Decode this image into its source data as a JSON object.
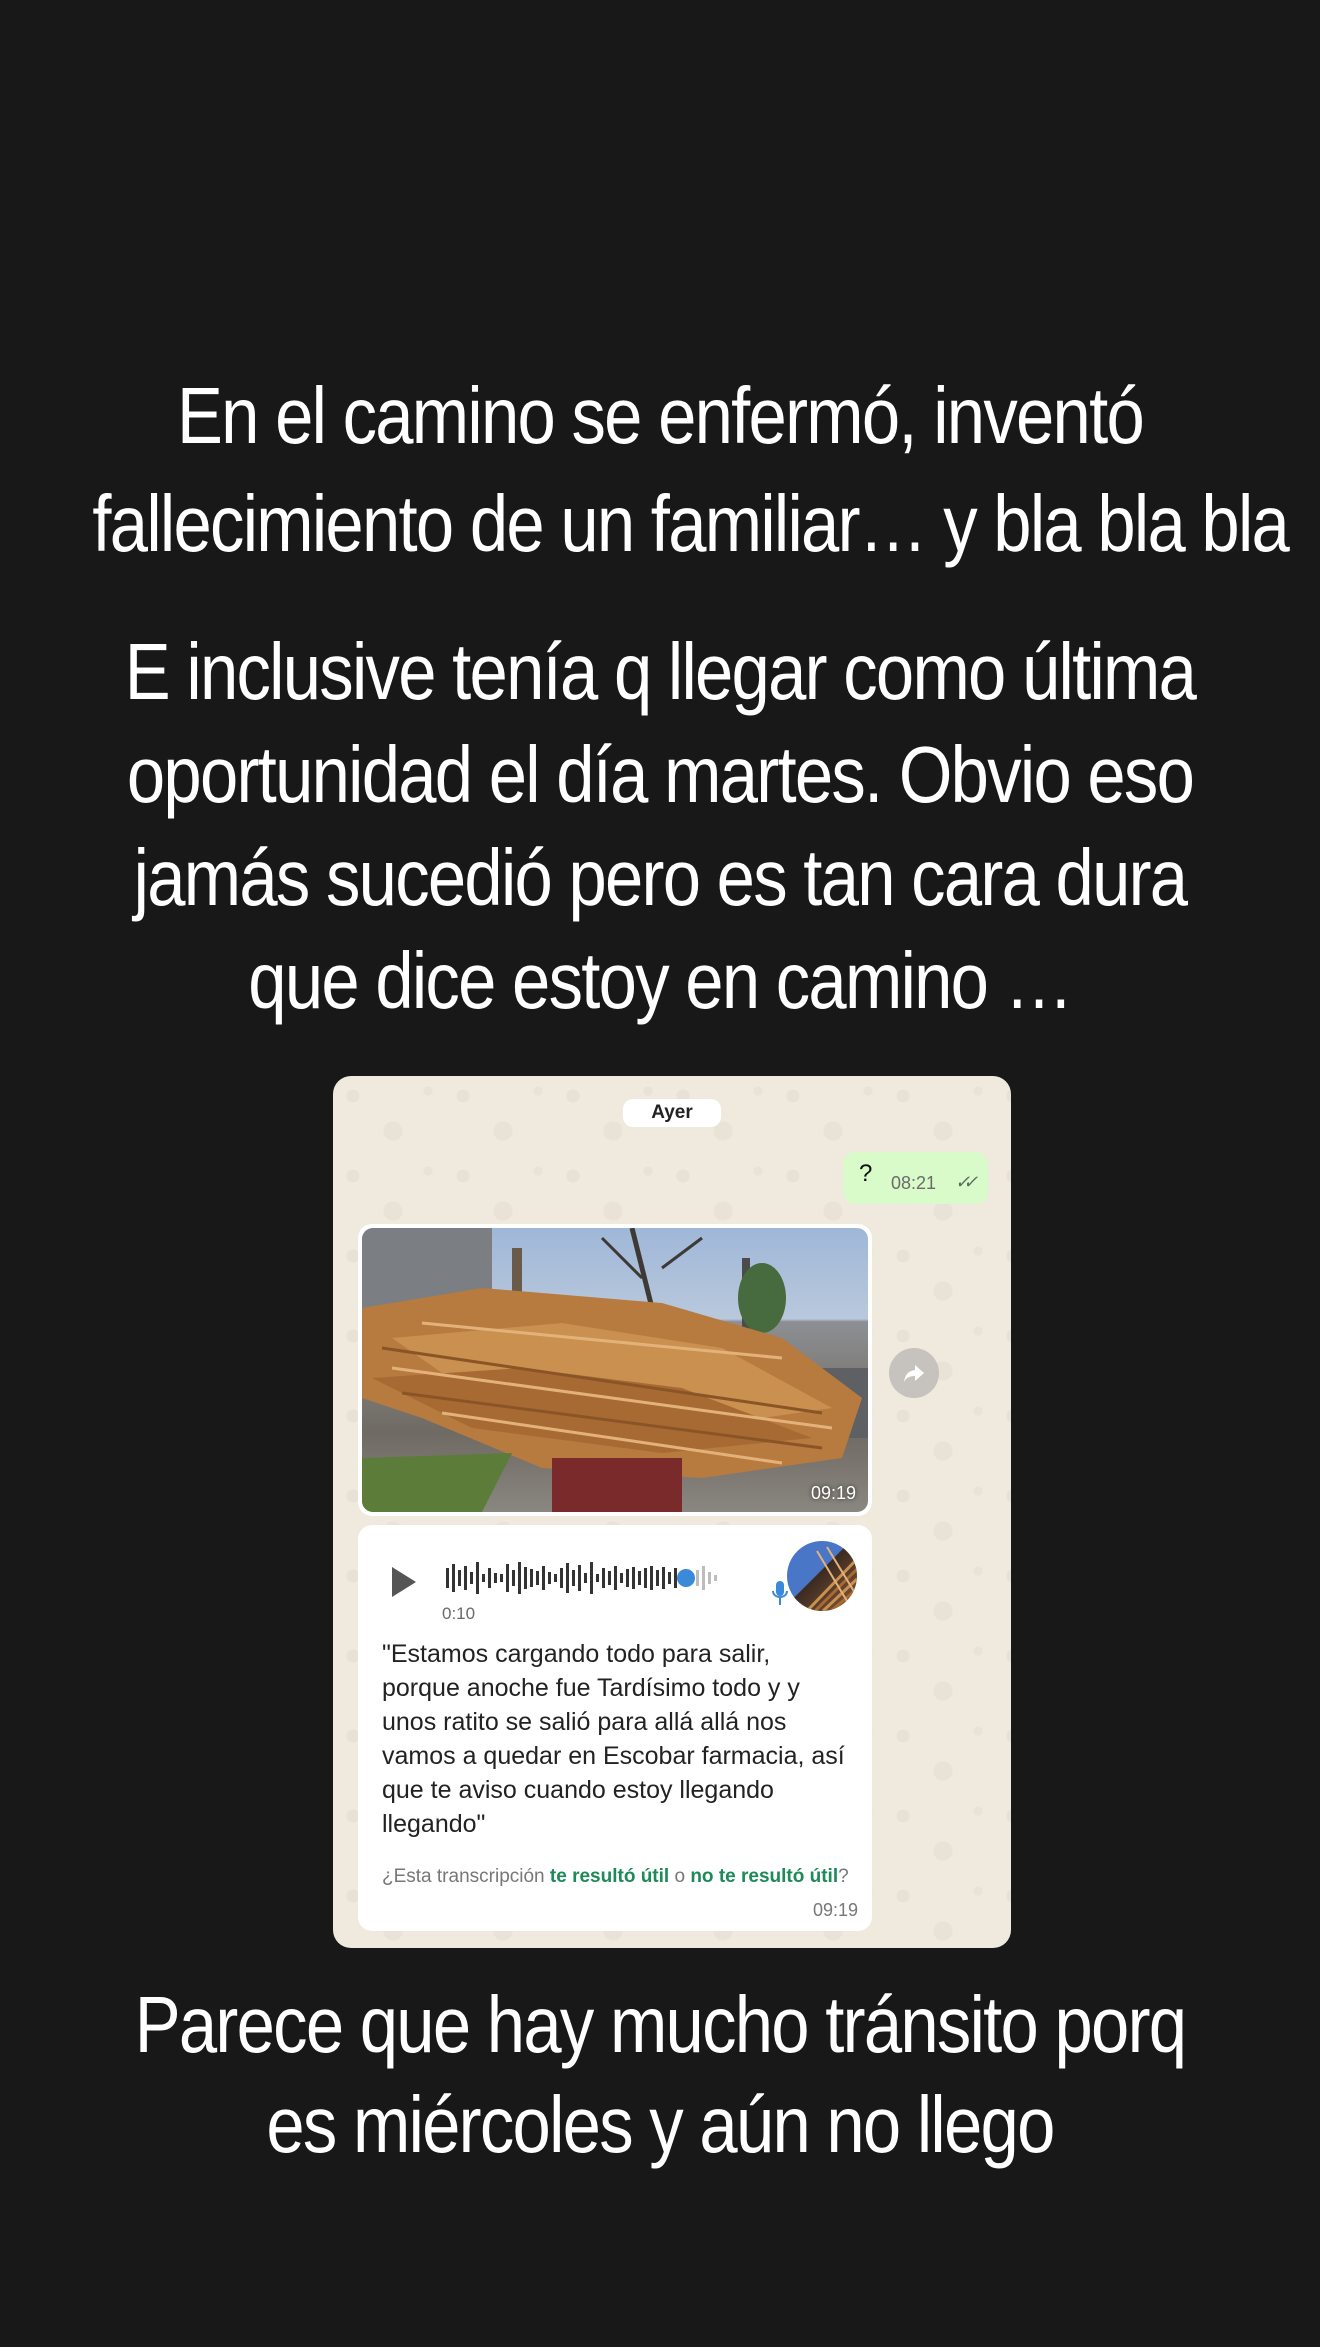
{
  "story": {
    "caption_1": [
      "En el camino se enfermó, inventó",
      "fallecimiento de un familiar… y bla bla bla"
    ],
    "caption_2": [
      "E inclusive tenía q llegar como última",
      "oportunidad el día martes. Obvio eso",
      "jamás sucedió pero es tan cara dura",
      "que dice estoy en camino …"
    ],
    "caption_3": [
      "Parece que hay mucho tránsito porq",
      "es miércoles y aún no llego"
    ]
  },
  "chat": {
    "date_chip": "Ayer",
    "outgoing_message": {
      "text": "?",
      "time": "08:21",
      "status_icon": "double-check-icon"
    },
    "photo_message": {
      "time": "09:19",
      "image_description_icon": "photo-lumber-pile"
    },
    "forward_icon": "forward-arrow-icon",
    "audio_message": {
      "duration": "0:10",
      "transcript": "\"Estamos cargando todo para salir, porque anoche fue Tardísimo todo y y unos ratito se salió para allá allá nos vamos a quedar en Escobar farmacia, así que te aviso cuando estoy llegando llegando\"",
      "feedback_prefix": "¿Esta transcripción ",
      "feedback_yes": "te resultó útil",
      "feedback_or": " o ",
      "feedback_no": "no te resultó útil",
      "feedback_suffix": "?",
      "time": "09:19"
    }
  },
  "colors": {
    "background": "#181818",
    "chat_bg": "#efe9de",
    "outgoing_bubble": "#d8fbc9",
    "link_green": "#1d8a57"
  }
}
